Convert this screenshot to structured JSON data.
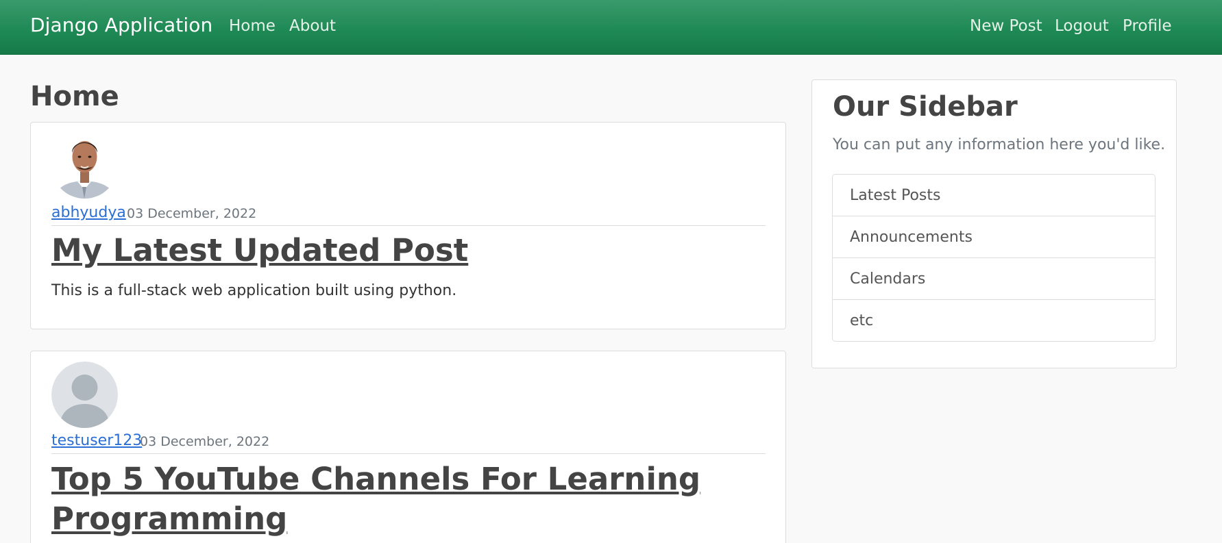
{
  "navbar": {
    "brand": "Django Application",
    "left_links": [
      "Home",
      "About"
    ],
    "right_links": [
      "New Post",
      "Logout",
      "Profile"
    ],
    "background": "#1f8a55"
  },
  "main": {
    "heading": "Home",
    "posts": [
      {
        "author": "abhyudya",
        "date": "03 December, 2022",
        "title": "My Latest Updated Post",
        "content": "This is a full-stack web application built using python.",
        "avatar": "profile-photo"
      },
      {
        "author": "testuser123",
        "date": "03 December, 2022",
        "title": "Top 5 YouTube Channels For Learning Programming",
        "avatar": "default-user-icon"
      }
    ]
  },
  "sidebar": {
    "title": "Our Sidebar",
    "text": "You can put any information here you'd like.",
    "items": [
      "Latest Posts",
      "Announcements",
      "Calendars",
      "etc"
    ]
  },
  "colors": {
    "link": "#2a6fd6",
    "muted": "#6c757d",
    "text": "#444444"
  }
}
